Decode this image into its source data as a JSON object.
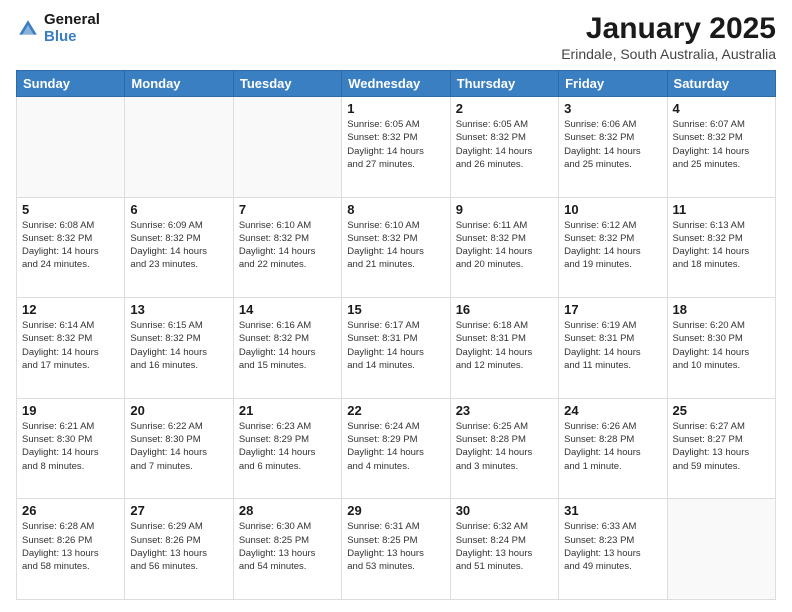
{
  "logo": {
    "line1": "General",
    "line2": "Blue"
  },
  "title": "January 2025",
  "subtitle": "Erindale, South Australia, Australia",
  "weekdays": [
    "Sunday",
    "Monday",
    "Tuesday",
    "Wednesday",
    "Thursday",
    "Friday",
    "Saturday"
  ],
  "weeks": [
    [
      {
        "day": "",
        "info": ""
      },
      {
        "day": "",
        "info": ""
      },
      {
        "day": "",
        "info": ""
      },
      {
        "day": "1",
        "info": "Sunrise: 6:05 AM\nSunset: 8:32 PM\nDaylight: 14 hours\nand 27 minutes."
      },
      {
        "day": "2",
        "info": "Sunrise: 6:05 AM\nSunset: 8:32 PM\nDaylight: 14 hours\nand 26 minutes."
      },
      {
        "day": "3",
        "info": "Sunrise: 6:06 AM\nSunset: 8:32 PM\nDaylight: 14 hours\nand 25 minutes."
      },
      {
        "day": "4",
        "info": "Sunrise: 6:07 AM\nSunset: 8:32 PM\nDaylight: 14 hours\nand 25 minutes."
      }
    ],
    [
      {
        "day": "5",
        "info": "Sunrise: 6:08 AM\nSunset: 8:32 PM\nDaylight: 14 hours\nand 24 minutes."
      },
      {
        "day": "6",
        "info": "Sunrise: 6:09 AM\nSunset: 8:32 PM\nDaylight: 14 hours\nand 23 minutes."
      },
      {
        "day": "7",
        "info": "Sunrise: 6:10 AM\nSunset: 8:32 PM\nDaylight: 14 hours\nand 22 minutes."
      },
      {
        "day": "8",
        "info": "Sunrise: 6:10 AM\nSunset: 8:32 PM\nDaylight: 14 hours\nand 21 minutes."
      },
      {
        "day": "9",
        "info": "Sunrise: 6:11 AM\nSunset: 8:32 PM\nDaylight: 14 hours\nand 20 minutes."
      },
      {
        "day": "10",
        "info": "Sunrise: 6:12 AM\nSunset: 8:32 PM\nDaylight: 14 hours\nand 19 minutes."
      },
      {
        "day": "11",
        "info": "Sunrise: 6:13 AM\nSunset: 8:32 PM\nDaylight: 14 hours\nand 18 minutes."
      }
    ],
    [
      {
        "day": "12",
        "info": "Sunrise: 6:14 AM\nSunset: 8:32 PM\nDaylight: 14 hours\nand 17 minutes."
      },
      {
        "day": "13",
        "info": "Sunrise: 6:15 AM\nSunset: 8:32 PM\nDaylight: 14 hours\nand 16 minutes."
      },
      {
        "day": "14",
        "info": "Sunrise: 6:16 AM\nSunset: 8:32 PM\nDaylight: 14 hours\nand 15 minutes."
      },
      {
        "day": "15",
        "info": "Sunrise: 6:17 AM\nSunset: 8:31 PM\nDaylight: 14 hours\nand 14 minutes."
      },
      {
        "day": "16",
        "info": "Sunrise: 6:18 AM\nSunset: 8:31 PM\nDaylight: 14 hours\nand 12 minutes."
      },
      {
        "day": "17",
        "info": "Sunrise: 6:19 AM\nSunset: 8:31 PM\nDaylight: 14 hours\nand 11 minutes."
      },
      {
        "day": "18",
        "info": "Sunrise: 6:20 AM\nSunset: 8:30 PM\nDaylight: 14 hours\nand 10 minutes."
      }
    ],
    [
      {
        "day": "19",
        "info": "Sunrise: 6:21 AM\nSunset: 8:30 PM\nDaylight: 14 hours\nand 8 minutes."
      },
      {
        "day": "20",
        "info": "Sunrise: 6:22 AM\nSunset: 8:30 PM\nDaylight: 14 hours\nand 7 minutes."
      },
      {
        "day": "21",
        "info": "Sunrise: 6:23 AM\nSunset: 8:29 PM\nDaylight: 14 hours\nand 6 minutes."
      },
      {
        "day": "22",
        "info": "Sunrise: 6:24 AM\nSunset: 8:29 PM\nDaylight: 14 hours\nand 4 minutes."
      },
      {
        "day": "23",
        "info": "Sunrise: 6:25 AM\nSunset: 8:28 PM\nDaylight: 14 hours\nand 3 minutes."
      },
      {
        "day": "24",
        "info": "Sunrise: 6:26 AM\nSunset: 8:28 PM\nDaylight: 14 hours\nand 1 minute."
      },
      {
        "day": "25",
        "info": "Sunrise: 6:27 AM\nSunset: 8:27 PM\nDaylight: 13 hours\nand 59 minutes."
      }
    ],
    [
      {
        "day": "26",
        "info": "Sunrise: 6:28 AM\nSunset: 8:26 PM\nDaylight: 13 hours\nand 58 minutes."
      },
      {
        "day": "27",
        "info": "Sunrise: 6:29 AM\nSunset: 8:26 PM\nDaylight: 13 hours\nand 56 minutes."
      },
      {
        "day": "28",
        "info": "Sunrise: 6:30 AM\nSunset: 8:25 PM\nDaylight: 13 hours\nand 54 minutes."
      },
      {
        "day": "29",
        "info": "Sunrise: 6:31 AM\nSunset: 8:25 PM\nDaylight: 13 hours\nand 53 minutes."
      },
      {
        "day": "30",
        "info": "Sunrise: 6:32 AM\nSunset: 8:24 PM\nDaylight: 13 hours\nand 51 minutes."
      },
      {
        "day": "31",
        "info": "Sunrise: 6:33 AM\nSunset: 8:23 PM\nDaylight: 13 hours\nand 49 minutes."
      },
      {
        "day": "",
        "info": ""
      }
    ]
  ]
}
